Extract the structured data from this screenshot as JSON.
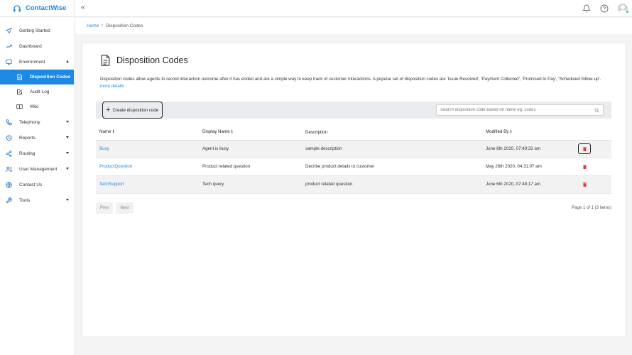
{
  "app": {
    "name": "ContactWise"
  },
  "sidebar": {
    "items": [
      {
        "label": "Getting Started",
        "icon": "send-icon"
      },
      {
        "label": "Dashboard",
        "icon": "trend-icon"
      },
      {
        "label": "Environment",
        "icon": "monitor-icon"
      },
      {
        "label": "Disposition Codes",
        "icon": "file-icon"
      },
      {
        "label": "Audit Log",
        "icon": "edit-icon"
      },
      {
        "label": "Wiki",
        "icon": "book-icon"
      },
      {
        "label": "Telephony",
        "icon": "phone-icon"
      },
      {
        "label": "Reports",
        "icon": "pie-icon"
      },
      {
        "label": "Routing",
        "icon": "share-icon"
      },
      {
        "label": "User Management",
        "icon": "users-icon"
      },
      {
        "label": "Contact Us",
        "icon": "globe-icon"
      },
      {
        "label": "Tools",
        "icon": "wrench-icon"
      }
    ]
  },
  "topbar": {
    "collapse": "«"
  },
  "breadcrumb": {
    "home": "Home",
    "sep": "/",
    "current": "Disposition Codes"
  },
  "page": {
    "title": "Disposition Codes",
    "description": "Disposition codes allow agents to record interaction outcome after it has ended and are a simple way to keep track of customer interactions. A popular set of disposition codes are 'Issue Resolved', 'Payment Collected', 'Promised to Pay', 'Scheduled follow-up'.",
    "more_details": "more details"
  },
  "toolbar": {
    "create_label": "Create disposition code",
    "search_placeholder": "Search disposition code based on name eg: code1"
  },
  "table": {
    "columns": {
      "name": "Name",
      "display_name": "Display Name",
      "description": "Description",
      "modified_by": "Modified By"
    },
    "sort_glyph": "⭳",
    "rows": [
      {
        "name": "Busy",
        "display_name": "Agent is busy",
        "description": "sample description",
        "modified_by": "June 6th 2020, 07:49:33 am"
      },
      {
        "name": "ProductQuestion",
        "display_name": "Product related question",
        "description": "Decribe product details to customer",
        "modified_by": "May 26th 2020, 04:31:07 am"
      },
      {
        "name": "TechSupport",
        "display_name": "Tech query",
        "description": "product related question",
        "modified_by": "June 6th 2020, 07:48:17 am"
      }
    ]
  },
  "pagination": {
    "prev": "Prev",
    "next": "Next",
    "info": "Page 1 of 1 (3 items)"
  },
  "colors": {
    "accent": "#1e88e5",
    "delete": "#e53935",
    "online": "#2ecc40"
  }
}
